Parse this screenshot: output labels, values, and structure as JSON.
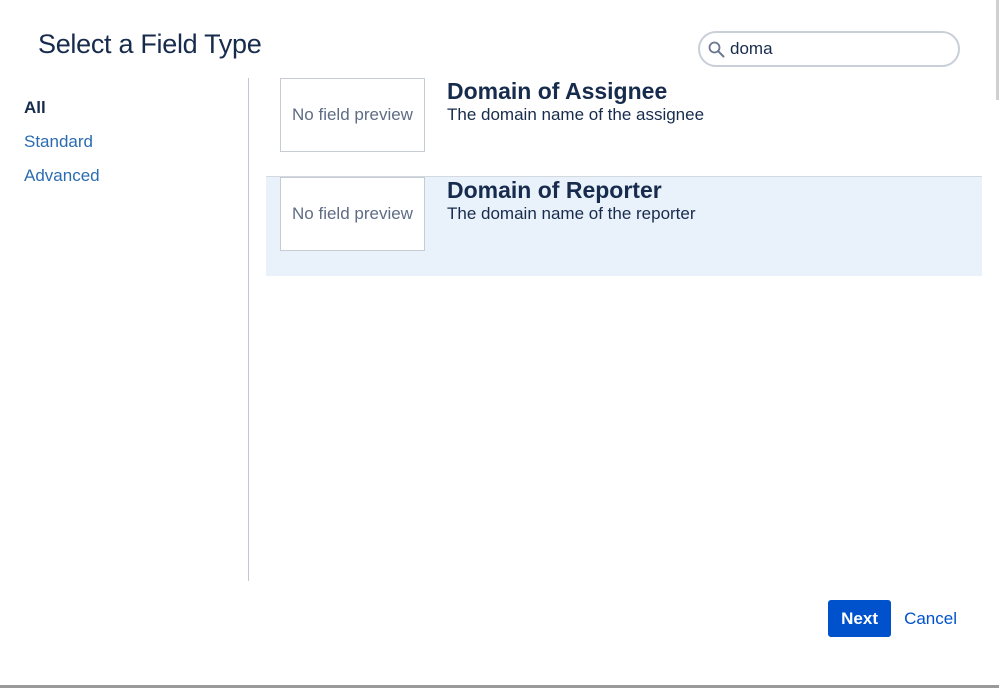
{
  "dialog": {
    "title": "Select a Field Type"
  },
  "search": {
    "value": "doma",
    "icon": "search-icon"
  },
  "sidebar": {
    "items": [
      {
        "label": "All",
        "active": true
      },
      {
        "label": "Standard",
        "active": false
      },
      {
        "label": "Advanced",
        "active": false
      }
    ]
  },
  "results": [
    {
      "preview": "No field preview",
      "title": "Domain of Assignee",
      "description": "The domain name of the assignee",
      "selected": false
    },
    {
      "preview": "No field preview",
      "title": "Domain of Reporter",
      "description": "The domain name of the reporter",
      "selected": true
    }
  ],
  "footer": {
    "next_label": "Next",
    "cancel_label": "Cancel"
  },
  "colors": {
    "primary": "#0052cc",
    "link": "#2b6cb0",
    "text": "#172b4d",
    "selected_bg": "#e9f1fb"
  }
}
